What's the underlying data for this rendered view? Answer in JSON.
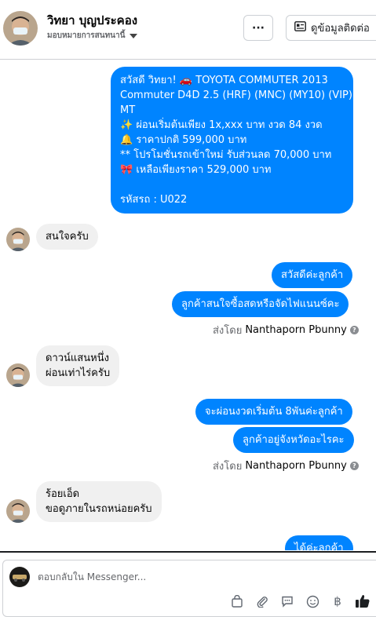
{
  "header": {
    "contact_name": "วิทยา บุญประคอง",
    "assign_label": "มอบหมายการสนทนานี้",
    "more_label": "···",
    "contact_info_label": "ดูข้อมูลติดต่อ"
  },
  "thread": {
    "intro_message": {
      "line1": "สวัสดี วิทยา! 🚗  TOYOTA COMMUTER 2013",
      "line2": "Commuter D4D 2.5 (HRF) (MNC) (MY10) (VIP)",
      "line3": "MT",
      "line4": "✨  ผ่อนเริ่มต้นเพียง 1x,xxx บาท งวด 84 งวด",
      "line5": "🔔  ราคาปกติ 599,000 บาท",
      "line6": "** โปรโมชั่นรถเข้าใหม่ รับส่วนลด 70,000 บาท",
      "line7": "🎀  เหลือเพียงราคา 529,000 บาท",
      "line8": "รหัสรถ : U022"
    },
    "msg_interested": "สนใจครับ",
    "msg_hello_customer": "สวัสดีค่ะลูกค้า",
    "msg_cash_or_finance": "ลูกค้าสนใจซื้อสดหรือจัดไฟแนนซ์คะ",
    "sent_by_prefix": "ส่งโดย",
    "sent_by_name": "Nanthaporn Pbunny",
    "msg_down_payment_line1": "ดาวน์แสนหนึ่ง",
    "msg_down_payment_line2": "ผ่อนเท่าไร่ครับ",
    "msg_installment_from": "จะผ่อนงวดเริ่มต้น 8พันค่ะลูกค้า",
    "msg_which_province": "ลูกค้าอยู่จังหวัดอะไรคะ",
    "msg_101_line1": "ร้อยเอ็ด",
    "msg_101_line2": "ขอดูภายในรถหน่อยครับ",
    "msg_ok": "ได้ค่ะลูกค้า"
  },
  "composer": {
    "placeholder": "ตอบกลับใน Messenger..."
  },
  "icons": [
    "shopping-bag-icon",
    "paperclip-icon",
    "quick-reply-icon",
    "emoji-icon",
    "baht-icon",
    "thumbs-up-icon"
  ],
  "colors": {
    "outgoing": "#0084ff",
    "incoming": "#f0f0f0",
    "thumb": "#1c1e21"
  }
}
